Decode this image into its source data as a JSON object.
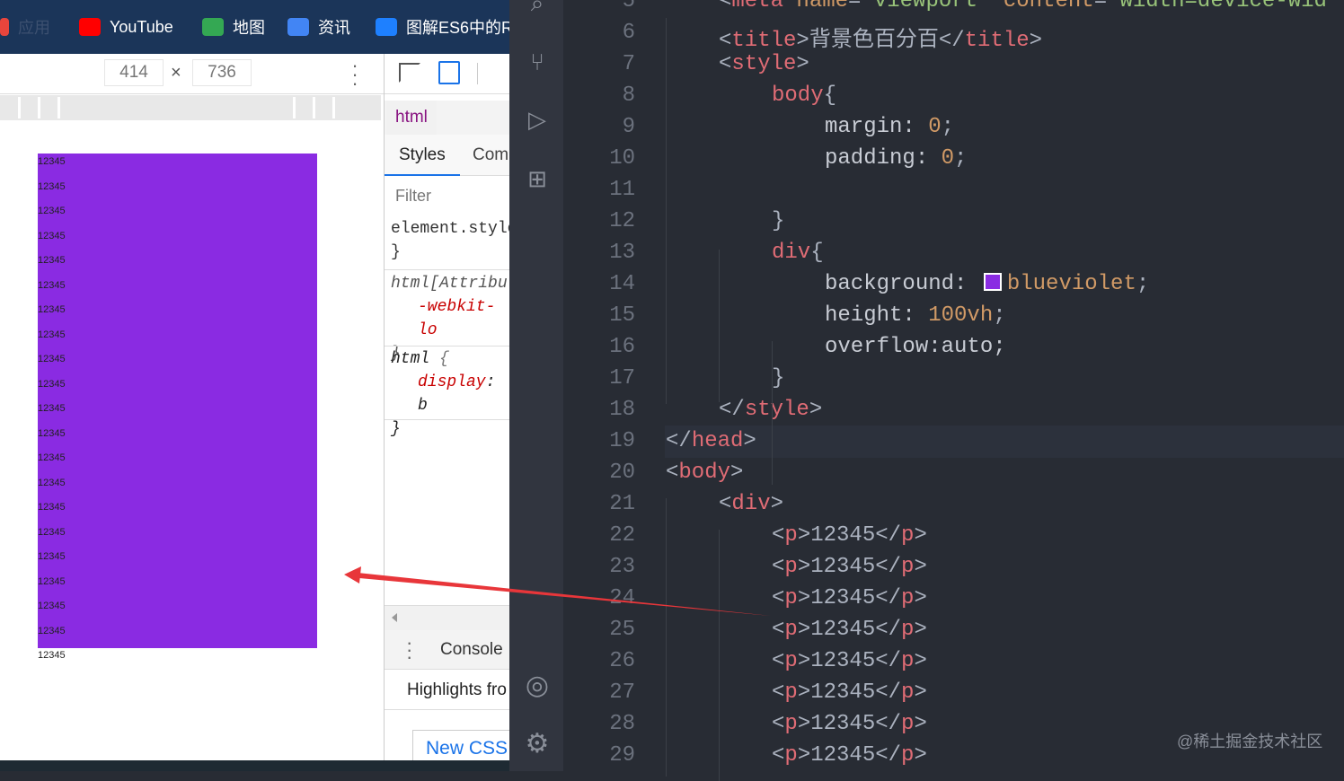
{
  "bookmarks": [
    {
      "label": "应用",
      "icon": "apps-grid-icon",
      "color": "#e8453c"
    },
    {
      "label": "YouTube",
      "icon": "youtube-icon",
      "color": "#ff0000"
    },
    {
      "label": "地图",
      "icon": "maps-icon",
      "color": "#34a853"
    },
    {
      "label": "资讯",
      "icon": "news-icon",
      "color": "#4285f4"
    },
    {
      "label": "图解ES6中的R",
      "icon": "juejin-icon",
      "color": "#1e80ff"
    }
  ],
  "device_toolbar": {
    "width": "414",
    "times": "×",
    "height": "736"
  },
  "preview": {
    "div_color": "#8a2be2",
    "items": [
      "12345",
      "12345",
      "12345",
      "12345",
      "12345",
      "12345",
      "12345",
      "12345",
      "12345",
      "12345",
      "12345",
      "12345",
      "12345",
      "12345",
      "12345",
      "12345",
      "12345",
      "12345",
      "12345",
      "12345",
      "12345"
    ]
  },
  "devtools": {
    "breadcrumb": "html",
    "tabs": [
      "Styles",
      "Com"
    ],
    "filter_placeholder": "Filter",
    "rules": [
      {
        "selector": "element.style",
        "open": " {",
        "close": "}"
      },
      {
        "selector": "html[Attribu",
        "prop": "-webkit-lo",
        "close": "}"
      },
      {
        "selector": "html",
        "open": " {",
        "prop": "display",
        "colon": ": b",
        "close": "}"
      }
    ],
    "drawer_tab": "Console",
    "drawer_text": "Highlights fro",
    "new_css_button": "New CSS"
  },
  "editor": {
    "lines": [
      {
        "n": "5",
        "indent": 1,
        "tokens": [
          [
            "<",
            "br"
          ],
          [
            "meta",
            "tag"
          ],
          [
            " name",
            "attr"
          ],
          [
            "=",
            "br"
          ],
          [
            "\"viewport\"",
            "str"
          ],
          [
            " content",
            "attr"
          ],
          [
            "=",
            "br"
          ],
          [
            "\"width=device-wid",
            "str"
          ]
        ]
      },
      {
        "n": "6",
        "indent": 1,
        "tokens": [
          [
            "<",
            "br"
          ],
          [
            "title",
            "tag"
          ],
          [
            ">",
            "br"
          ],
          [
            "背景色百分百",
            "txt"
          ],
          [
            "</",
            "br"
          ],
          [
            "title",
            "tag"
          ],
          [
            ">",
            "br"
          ]
        ]
      },
      {
        "n": "7",
        "indent": 1,
        "tokens": [
          [
            "<",
            "br"
          ],
          [
            "style",
            "tag"
          ],
          [
            ">",
            "br"
          ]
        ]
      },
      {
        "n": "8",
        "indent": 2,
        "tokens": [
          [
            "body",
            "tag"
          ],
          [
            "{",
            "br"
          ]
        ]
      },
      {
        "n": "9",
        "indent": 3,
        "tokens": [
          [
            "margin: ",
            "prop"
          ],
          [
            "0",
            "num"
          ],
          [
            ";",
            "br"
          ]
        ]
      },
      {
        "n": "10",
        "indent": 3,
        "tokens": [
          [
            "padding: ",
            "prop"
          ],
          [
            "0",
            "num"
          ],
          [
            ";",
            "br"
          ]
        ]
      },
      {
        "n": "11",
        "indent": 0,
        "tokens": []
      },
      {
        "n": "12",
        "indent": 2,
        "tokens": [
          [
            "}",
            "br"
          ]
        ]
      },
      {
        "n": "13",
        "indent": 2,
        "tokens": [
          [
            "div",
            "tag"
          ],
          [
            "{",
            "br"
          ]
        ]
      },
      {
        "n": "14",
        "indent": 3,
        "tokens": [
          [
            "background: ",
            "prop"
          ],
          [
            "■",
            "swatch"
          ],
          [
            "blueviolet",
            "num"
          ],
          [
            ";",
            "br"
          ]
        ]
      },
      {
        "n": "15",
        "indent": 3,
        "tokens": [
          [
            "height: ",
            "prop"
          ],
          [
            "100vh",
            "num"
          ],
          [
            ";",
            "br"
          ]
        ]
      },
      {
        "n": "16",
        "indent": 3,
        "tokens": [
          [
            "overflow:auto;",
            "prop"
          ]
        ]
      },
      {
        "n": "17",
        "indent": 2,
        "tokens": [
          [
            "}",
            "br"
          ]
        ]
      },
      {
        "n": "18",
        "indent": 1,
        "tokens": [
          [
            "</",
            "br"
          ],
          [
            "style",
            "tag"
          ],
          [
            ">",
            "br"
          ]
        ]
      },
      {
        "n": "19",
        "indent": 0,
        "tokens": [
          [
            "</",
            "br"
          ],
          [
            "head",
            "tag"
          ],
          [
            ">",
            "br"
          ]
        ]
      },
      {
        "n": "20",
        "indent": 0,
        "tokens": [
          [
            "<",
            "br"
          ],
          [
            "body",
            "tag"
          ],
          [
            ">",
            "br"
          ]
        ]
      },
      {
        "n": "21",
        "indent": 1,
        "tokens": [
          [
            "<",
            "br"
          ],
          [
            "div",
            "tag"
          ],
          [
            ">",
            "br"
          ]
        ]
      },
      {
        "n": "22",
        "indent": 2,
        "tokens": [
          [
            "<",
            "br"
          ],
          [
            "p",
            "tag"
          ],
          [
            ">",
            "br"
          ],
          [
            "12345",
            "txt"
          ],
          [
            "</",
            "br"
          ],
          [
            "p",
            "tag"
          ],
          [
            ">",
            "br"
          ]
        ]
      },
      {
        "n": "23",
        "indent": 2,
        "tokens": [
          [
            "<",
            "br"
          ],
          [
            "p",
            "tag"
          ],
          [
            ">",
            "br"
          ],
          [
            "12345",
            "txt"
          ],
          [
            "</",
            "br"
          ],
          [
            "p",
            "tag"
          ],
          [
            ">",
            "br"
          ]
        ]
      },
      {
        "n": "24",
        "indent": 2,
        "tokens": [
          [
            "<",
            "br"
          ],
          [
            "p",
            "tag"
          ],
          [
            ">",
            "br"
          ],
          [
            "12345",
            "txt"
          ],
          [
            "</",
            "br"
          ],
          [
            "p",
            "tag"
          ],
          [
            ">",
            "br"
          ]
        ]
      },
      {
        "n": "25",
        "indent": 2,
        "tokens": [
          [
            "<",
            "br"
          ],
          [
            "p",
            "tag"
          ],
          [
            ">",
            "br"
          ],
          [
            "12345",
            "txt"
          ],
          [
            "</",
            "br"
          ],
          [
            "p",
            "tag"
          ],
          [
            ">",
            "br"
          ]
        ]
      },
      {
        "n": "26",
        "indent": 2,
        "tokens": [
          [
            "<",
            "br"
          ],
          [
            "p",
            "tag"
          ],
          [
            ">",
            "br"
          ],
          [
            "12345",
            "txt"
          ],
          [
            "</",
            "br"
          ],
          [
            "p",
            "tag"
          ],
          [
            ">",
            "br"
          ]
        ]
      },
      {
        "n": "27",
        "indent": 2,
        "tokens": [
          [
            "<",
            "br"
          ],
          [
            "p",
            "tag"
          ],
          [
            ">",
            "br"
          ],
          [
            "12345",
            "txt"
          ],
          [
            "</",
            "br"
          ],
          [
            "p",
            "tag"
          ],
          [
            ">",
            "br"
          ]
        ]
      },
      {
        "n": "28",
        "indent": 2,
        "tokens": [
          [
            "<",
            "br"
          ],
          [
            "p",
            "tag"
          ],
          [
            ">",
            "br"
          ],
          [
            "12345",
            "txt"
          ],
          [
            "</",
            "br"
          ],
          [
            "p",
            "tag"
          ],
          [
            ">",
            "br"
          ]
        ]
      },
      {
        "n": "29",
        "indent": 2,
        "tokens": [
          [
            "<",
            "br"
          ],
          [
            "p",
            "tag"
          ],
          [
            ">",
            "br"
          ],
          [
            "12345",
            "txt"
          ],
          [
            "</",
            "br"
          ],
          [
            "p",
            "tag"
          ],
          [
            ">",
            "br"
          ]
        ]
      }
    ]
  },
  "watermark": "@稀土掘金技术社区",
  "annotation_color": "#e8363a"
}
